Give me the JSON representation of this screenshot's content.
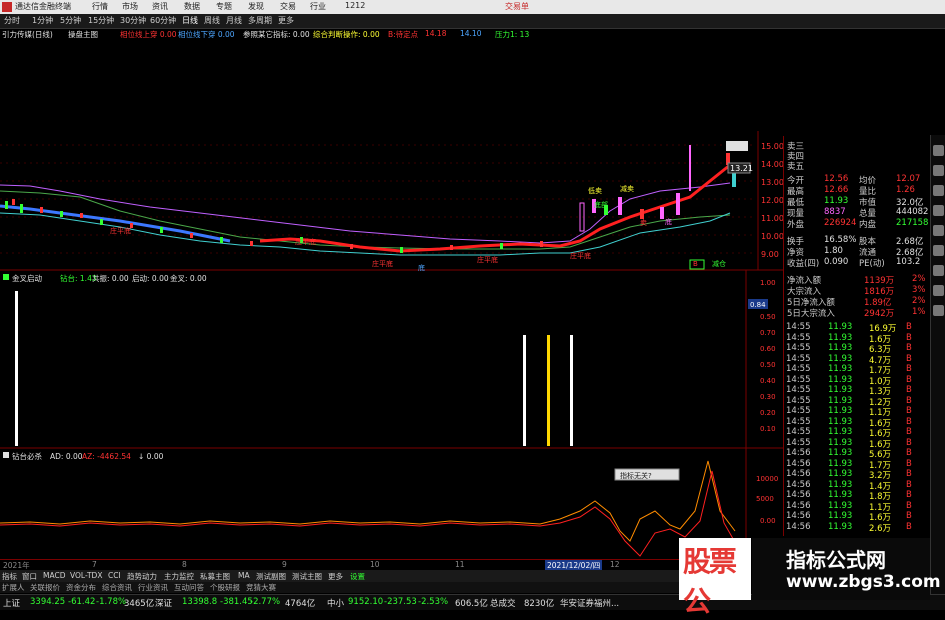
{
  "title_bar": {
    "app_title": "通达信金融终端",
    "menus": [
      "行情",
      "市场",
      "资讯",
      "数据",
      "专题",
      "发现",
      "交易",
      "行业",
      "1212"
    ],
    "right_text": "交易单"
  },
  "period_bar": [
    "分时",
    "1分钟",
    "5分钟",
    "15分钟",
    "30分钟",
    "60分钟",
    "日线",
    "周线",
    "月线",
    "多周期",
    "更多"
  ],
  "indicator_line": {
    "stock": "引力传媒(日线)",
    "items": [
      {
        "text": "操盘主图",
        "color": "#e0e0e0"
      },
      {
        "text": "相位线上穿 0.00",
        "color": "#ff3333"
      },
      {
        "text": "相位线下穿 0.00",
        "color": "#4da6ff"
      },
      {
        "text": "参照某它指标: 0.00",
        "color": "#e0e0e0"
      },
      {
        "text": "综合判断操作: 0.00",
        "color": "#ffff33"
      },
      {
        "text": "B:待定点",
        "color": "#ff3333"
      },
      {
        "text": "14.18",
        "color": "#ff3333"
      },
      {
        "text": "14.10",
        "color": "#4da6ff"
      },
      {
        "text": "压力1: 13",
        "color": "#33ff33"
      }
    ]
  },
  "price_axis": [
    "15.00",
    "14.00",
    "13.00",
    "12.00",
    "11.00",
    "10.00",
    "9.00"
  ],
  "main_chart_marks": {
    "current_price_tag": "13.21",
    "labels": [
      "低卖",
      "减卖",
      "底部",
      "庄平底",
      "庄平底",
      "庄平底",
      "庄平底",
      "底",
      "庄平底",
      "底",
      "卖",
      "B",
      "减仓"
    ]
  },
  "sub1": {
    "header": [
      {
        "text": "金叉启动",
        "color": "#e0e0e0"
      },
      {
        "text": "钻台: 1.43",
        "color": "#33ff33"
      },
      {
        "text": "共振: 0.00",
        "color": "#e0e0e0"
      },
      {
        "text": "启动: 0.00",
        "color": "#e0e0e0"
      },
      {
        "text": "金叉: 0.00",
        "color": "#e0e0e0"
      }
    ],
    "axis": [
      "1.00",
      "0.84",
      "0.50",
      "0.70",
      "0.60",
      "0.50",
      "0.40",
      "0.30",
      "0.20",
      "0.10"
    ]
  },
  "sub2": {
    "header": [
      {
        "text": "钻台必杀",
        "color": "#e0e0e0"
      },
      {
        "text": "AD: 0.00",
        "color": "#e0e0e0"
      },
      {
        "text": "AZ: -4462.54",
        "color": "#ff3333"
      },
      {
        "text": "↓ 0.00",
        "color": "#e0e0e0"
      }
    ],
    "axis": [
      "10000",
      "5000",
      "0.00"
    ],
    "popup": "指标无关?"
  },
  "quote_panel": {
    "top": [
      {
        "label": "卖三",
        "value": ""
      },
      {
        "label": "卖四",
        "value": ""
      },
      {
        "label": "卖五",
        "value": ""
      }
    ],
    "stats": [
      {
        "l1": "今开",
        "v1": "12.56",
        "c1": "#ff3333",
        "l2": "均价",
        "v2": "12.07",
        "c2": "#ff3333"
      },
      {
        "l1": "最高",
        "v1": "12.66",
        "c1": "#ff3333",
        "l2": "量比",
        "v2": "1.26",
        "c2": "#ff3333"
      },
      {
        "l1": "最低",
        "v1": "11.93",
        "c1": "#33ff33",
        "l2": "市值",
        "v2": "32.0亿",
        "c2": "#e0e0e0"
      },
      {
        "l1": "现量",
        "v1": "8837",
        "c1": "#ff66ff",
        "l2": "总量",
        "v2": "444082",
        "c2": "#e0e0e0"
      },
      {
        "l1": "外盘",
        "v1": "226924",
        "c1": "#ff3333",
        "l2": "内盘",
        "v2": "217158",
        "c2": "#33ff33"
      },
      {
        "l1": "换手",
        "v1": "16.58%",
        "c1": "#e0e0e0",
        "l2": "股本",
        "v2": "2.68亿",
        "c2": "#e0e0e0"
      },
      {
        "l1": "净资",
        "v1": "1.80",
        "c1": "#e0e0e0",
        "l2": "流通",
        "v2": "2.68亿",
        "c2": "#e0e0e0"
      },
      {
        "l1": "收益(四)",
        "v1": "0.090",
        "c1": "#e0e0e0",
        "l2": "PE(动)",
        "v2": "103.2",
        "c2": "#e0e0e0"
      }
    ],
    "flows": [
      {
        "label": "净流入额",
        "v": "1139万",
        "p": "2%"
      },
      {
        "label": "大宗流入",
        "v": "1816万",
        "p": "3%"
      },
      {
        "label": "5日净流入额",
        "v": "1.89亿",
        "p": "2%"
      },
      {
        "label": "5日大宗流入",
        "v": "2942万",
        "p": "1%"
      }
    ],
    "ticks": [
      {
        "t": "14:55",
        "p": "11.93",
        "v": "16.9万",
        "d": "B"
      },
      {
        "t": "14:55",
        "p": "11.93",
        "v": "1.6万",
        "d": "B"
      },
      {
        "t": "14:55",
        "p": "11.93",
        "v": "6.3万",
        "d": "B"
      },
      {
        "t": "14:55",
        "p": "11.93",
        "v": "4.7万",
        "d": "B"
      },
      {
        "t": "14:55",
        "p": "11.93",
        "v": "1.7万",
        "d": "B"
      },
      {
        "t": "14:55",
        "p": "11.93",
        "v": "1.0万",
        "d": "B"
      },
      {
        "t": "14:55",
        "p": "11.93",
        "v": "1.3万",
        "d": "B"
      },
      {
        "t": "14:55",
        "p": "11.93",
        "v": "1.2万",
        "d": "B"
      },
      {
        "t": "14:55",
        "p": "11.93",
        "v": "1.1万",
        "d": "B"
      },
      {
        "t": "14:55",
        "p": "11.93",
        "v": "1.6万",
        "d": "B"
      },
      {
        "t": "14:55",
        "p": "11.93",
        "v": "1.6万",
        "d": "B"
      },
      {
        "t": "14:55",
        "p": "11.93",
        "v": "1.6万",
        "d": "B"
      },
      {
        "t": "14:56",
        "p": "11.93",
        "v": "5.6万",
        "d": "B"
      },
      {
        "t": "14:56",
        "p": "11.93",
        "v": "1.7万",
        "d": "B"
      },
      {
        "t": "14:56",
        "p": "11.93",
        "v": "3.2万",
        "d": "B"
      },
      {
        "t": "14:56",
        "p": "11.93",
        "v": "1.4万",
        "d": "B"
      },
      {
        "t": "14:56",
        "p": "11.93",
        "v": "1.8万",
        "d": "B"
      },
      {
        "t": "14:56",
        "p": "11.93",
        "v": "1.1万",
        "d": "B"
      },
      {
        "t": "14:56",
        "p": "11.93",
        "v": "1.6万",
        "d": "B"
      },
      {
        "t": "14:56",
        "p": "11.93",
        "v": "2.6万",
        "d": "B"
      }
    ]
  },
  "date_bar": {
    "items": [
      "2021年",
      "7",
      "8",
      "9",
      "10",
      "11",
      "12"
    ],
    "highlight": "2021/12/02/四"
  },
  "tab_bar": [
    "指标",
    "窗口",
    "MACD",
    "VOL-TDX",
    "CCI",
    "趋势动力",
    "主力监控",
    "私募主图",
    "MA",
    "测试副图",
    "测试主图",
    "更多",
    "设置"
  ],
  "tab_bar2": [
    "扩展人",
    "关联报价",
    "资金分布",
    "综合资讯",
    "行业资讯",
    "互动问答",
    "个股研报",
    "竞猜大赛"
  ],
  "status_bar": [
    {
      "text": "上证",
      "color": "#e0e0e0"
    },
    {
      "text": "3394.25",
      "color": "#33ff33"
    },
    {
      "text": "-61.42",
      "color": "#33ff33"
    },
    {
      "text": "-1.78%",
      "color": "#33ff33"
    },
    {
      "text": "3465亿",
      "color": "#e0e0e0"
    },
    {
      "text": "深证",
      "color": "#e0e0e0"
    },
    {
      "text": "13398.8",
      "color": "#33ff33"
    },
    {
      "text": "-381.45",
      "color": "#33ff33"
    },
    {
      "text": "-2.77%",
      "color": "#33ff33"
    },
    {
      "text": "4764亿",
      "color": "#e0e0e0"
    },
    {
      "text": "中小",
      "color": "#e0e0e0"
    },
    {
      "text": "9152.10",
      "color": "#33ff33"
    },
    {
      "text": "-237.53",
      "color": "#33ff33"
    },
    {
      "text": "-2.53%",
      "color": "#33ff33"
    },
    {
      "text": "606.5亿",
      "color": "#e0e0e0"
    },
    {
      "text": "总成交",
      "color": "#e0e0e0"
    },
    {
      "text": "8230亿",
      "color": "#e0e0e0"
    },
    {
      "text": "华安证券福州...",
      "color": "#e0e0e0"
    }
  ],
  "watermark": {
    "big": "股票公",
    "line1": "指标公式网",
    "line2": "www.zbgs3.com"
  },
  "colors": {
    "up": "#ff3333",
    "down": "#33ff33",
    "panel_border": "#7a0000",
    "accent_blue": "#4da6ff"
  }
}
